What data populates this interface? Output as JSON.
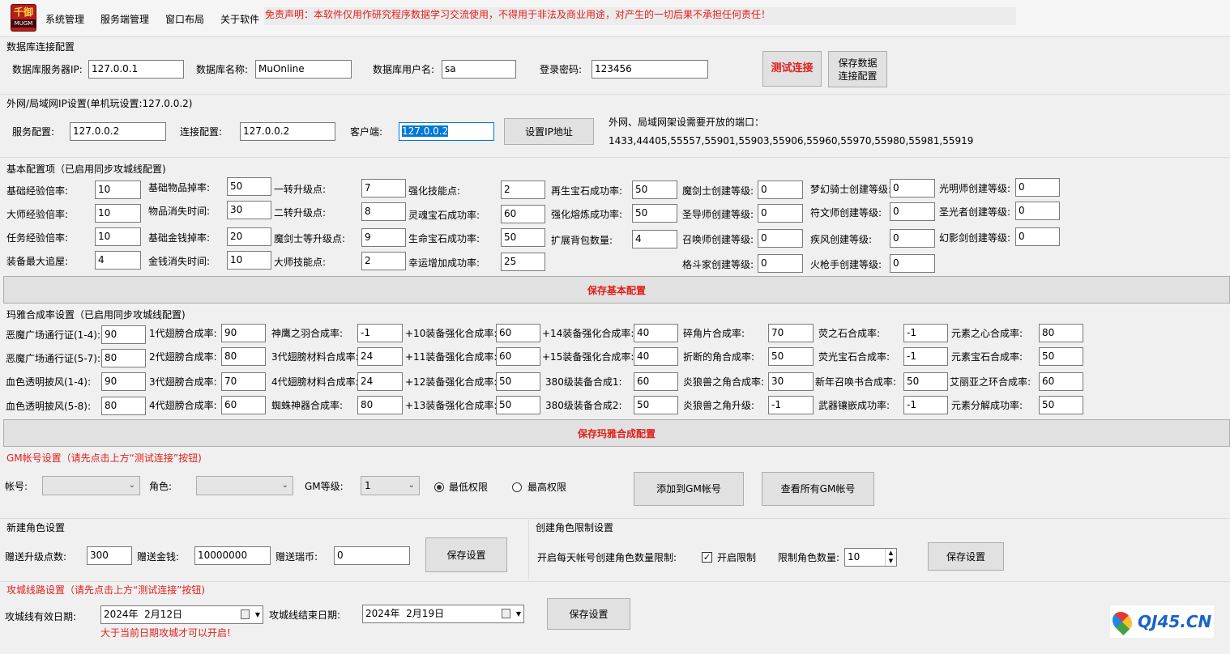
{
  "menu": {
    "logo_text": "千御",
    "logo_sub": "MUGM",
    "items": [
      "系统管理",
      "服务端管理",
      "窗口布局",
      "关于软件"
    ],
    "disclaimer": "免责声明：本软件仅用作研究程序数据学习交流使用，不得用于非法及商业用途，对产生的一切后果不承担任何责任！"
  },
  "db": {
    "title": "数据库连接配置",
    "ip_label": "数据库服务器IP:",
    "ip": "127.0.0.1",
    "name_label": "数据库名称:",
    "name": "MuOnline",
    "user_label": "数据库用户名:",
    "user": "sa",
    "pwd_label": "登录密码:",
    "pwd": "123456",
    "test_btn": "测试连接",
    "save_btn_1": "保存数据",
    "save_btn_2": "连接配置"
  },
  "net": {
    "title": "外网/局域网IP设置(单机玩设置:127.0.0.2)",
    "server_label": "服务配置:",
    "server": "127.0.0.2",
    "conn_label": "连接配置:",
    "conn": "127.0.0.2",
    "client_label": "客户端:",
    "client": "127.0.0.2",
    "set_btn": "设置IP地址",
    "ports_label": "外网、局域网架设需要开放的端口：",
    "ports": "1433,44405,55557,55901,55903,55906,55960,55970,55980,55981,55919"
  },
  "basic": {
    "title": "基本配置项（已启用同步攻城线配置)",
    "save_btn": "保存基本配置",
    "fields": [
      {
        "label": "基础经验倍率:",
        "value": "10"
      },
      {
        "label": "大师经验倍率:",
        "value": "10"
      },
      {
        "label": "任务经验倍率:",
        "value": "10"
      },
      {
        "label": "装备最大追屋:",
        "value": "4"
      },
      {
        "label": "基础物品掉率:",
        "value": "50"
      },
      {
        "label": "物品消失时间:",
        "value": "30"
      },
      {
        "label": "基础金钱掉率:",
        "value": "20"
      },
      {
        "label": "金钱消失时间:",
        "value": "10"
      },
      {
        "label": "一转升级点:",
        "value": "7"
      },
      {
        "label": "二转升级点:",
        "value": "8"
      },
      {
        "label": "魔剑士等升级点:",
        "value": "9"
      },
      {
        "label": "大师技能点:",
        "value": "2"
      },
      {
        "label": "强化技能点:",
        "value": "2"
      },
      {
        "label": "灵魂宝石成功率:",
        "value": "60"
      },
      {
        "label": "生命宝石成功率:",
        "value": "50"
      },
      {
        "label": "幸运增加成功率:",
        "value": "25"
      },
      {
        "label": "再生宝石成功率:",
        "value": "50"
      },
      {
        "label": "强化熔炼成功率:",
        "value": "50"
      },
      {
        "label": "扩展背包数量:",
        "value": "4"
      },
      {
        "label": "魔剑士创建等级:",
        "value": "0"
      },
      {
        "label": "圣导师创建等级:",
        "value": "0"
      },
      {
        "label": "召唤师创建等级:",
        "value": "0"
      },
      {
        "label": "格斗家创建等级:",
        "value": "0"
      },
      {
        "label": "梦幻骑士创建等级:",
        "value": "0"
      },
      {
        "label": "符文师创建等级:",
        "value": "0"
      },
      {
        "label": "疾风创建等级:",
        "value": "0"
      },
      {
        "label": "火枪手创建等级:",
        "value": "0"
      },
      {
        "label": "光明师创建等级:",
        "value": "0"
      },
      {
        "label": "圣光者创建等级:",
        "value": "0"
      },
      {
        "label": "幻影剑创建等级:",
        "value": "0"
      }
    ]
  },
  "maya": {
    "title": "玛雅合成率设置（已启用同步攻城线配置)",
    "save_btn": "保存玛雅合成配置",
    "fields": [
      {
        "label": "恶魔广场通行证(1-4):",
        "value": "90"
      },
      {
        "label": "恶魔广场通行证(5-7):",
        "value": "80"
      },
      {
        "label": "血色透明披风(1-4):",
        "value": "90"
      },
      {
        "label": "血色透明披风(5-8):",
        "value": "80"
      },
      {
        "label": "1代翅膀合成率:",
        "value": "90"
      },
      {
        "label": "2代翅膀合成率:",
        "value": "80"
      },
      {
        "label": "3代翅膀合成率:",
        "value": "70"
      },
      {
        "label": "4代翅膀合成率:",
        "value": "60"
      },
      {
        "label": "神鹰之羽合成率:",
        "value": "-1"
      },
      {
        "label": "3代翅膀材料合成率:",
        "value": "24"
      },
      {
        "label": "4代翅膀材料合成率:",
        "value": "24"
      },
      {
        "label": "蜘蛛神器合成率:",
        "value": "80"
      },
      {
        "label": "+10装备强化合成率:",
        "value": "60"
      },
      {
        "label": "+11装备强化合成率:",
        "value": "60"
      },
      {
        "label": "+12装备强化合成率:",
        "value": "50"
      },
      {
        "label": "+13装备强化合成率:",
        "value": "50"
      },
      {
        "label": "+14装备强化合成率:",
        "value": "40"
      },
      {
        "label": "+15装备强化合成率:",
        "value": "40"
      },
      {
        "label": "380级装备合成1:",
        "value": "60"
      },
      {
        "label": "380级装备合成2:",
        "value": "50"
      },
      {
        "label": "碎角片合成率:",
        "value": "70"
      },
      {
        "label": "折断的角合成率:",
        "value": "50"
      },
      {
        "label": "炎狼兽之角合成率:",
        "value": "30"
      },
      {
        "label": "炎狼兽之角升级:",
        "value": "-1"
      },
      {
        "label": "荧之石合成率:",
        "value": "-1"
      },
      {
        "label": "荧光宝石合成率:",
        "value": "-1"
      },
      {
        "label": "新年召唤书合成率:",
        "value": "50"
      },
      {
        "label": "武器镶嵌成功率:",
        "value": "-1"
      },
      {
        "label": "元素之心合成率:",
        "value": "80"
      },
      {
        "label": "元素宝石合成率:",
        "value": "50"
      },
      {
        "label": "艾丽亚之环合成率:",
        "value": "60"
      },
      {
        "label": "元素分解成功率:",
        "value": "50"
      }
    ]
  },
  "gm": {
    "title": "GM帐号设置（请先点击上方“测试连接”按钮)",
    "account_label": "帐号:",
    "account": "",
    "role_label": "角色:",
    "role": "",
    "level_label": "GM等级:",
    "level": "1",
    "radio_low": "最低权限",
    "radio_high": "最高权限",
    "add_btn": "添加到GM帐号",
    "view_btn": "查看所有GM帐号"
  },
  "newrole": {
    "title": "新建角色设置",
    "points_label": "赠送升级点数:",
    "points": "300",
    "money_label": "赠送金钱:",
    "money": "10000000",
    "coin_label": "赠送瑞币:",
    "coin": "0",
    "save_btn": "保存设置"
  },
  "limit": {
    "title": "创建角色限制设置",
    "daily_label": "开启每天帐号创建角色数量限制:",
    "check_label": "开启限制",
    "count_label": "限制角色数量:",
    "count": "10",
    "save_btn": "保存设置"
  },
  "siege": {
    "title": "攻城线路设置（请先点击上方“测试连接”按钮)",
    "start_label": "攻城线有效日期:",
    "start": "2024年  2月12日",
    "end_label": "攻城线结束日期:",
    "end": "2024年  2月19日",
    "save_btn": "保存设置",
    "note": "大于当前日期攻城才可以开启!"
  },
  "watermark": "QJ45.CN",
  "colors": {
    "accent_red": "#e0201c",
    "watermark_blue": "#1a63c7"
  }
}
